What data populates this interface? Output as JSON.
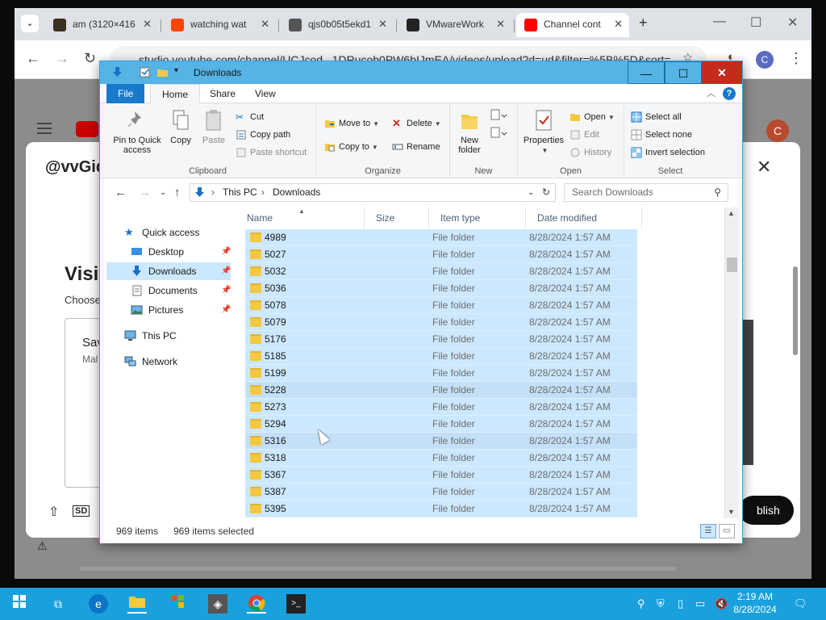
{
  "browser": {
    "tabs": [
      {
        "title": "am (3120×416",
        "favicon_color": "#3a3020"
      },
      {
        "title": "watching wat",
        "favicon_color": "#ff4500"
      },
      {
        "title": "qjs0b05t5ekd1",
        "favicon_color": "#555555"
      },
      {
        "title": "VMwareWork",
        "favicon_color": "#222222"
      },
      {
        "title": "Channel cont",
        "favicon_color": "#ff0000",
        "active": true
      }
    ],
    "url": "studio.youtube.com/channel/UCJcod...1DRucob0PW6bIJmEA/videos/upload?d=ud&filter=%5B%5D&sort=",
    "profile_initial": "C"
  },
  "youtube": {
    "channel": "@vvGid",
    "visibility_title": "Visil",
    "choose_text": "Choose",
    "save_text": "Sav",
    "make_text": "Mal",
    "publish_label": "blish",
    "user_initial": "C",
    "sd_badge": "SD"
  },
  "explorer": {
    "title": "Downloads",
    "ribbon_tabs": [
      "File",
      "Home",
      "Share",
      "View"
    ],
    "active_tab": "Home",
    "ribbon": {
      "clipboard": {
        "label": "Clipboard",
        "pin": "Pin to Quick access",
        "copy": "Copy",
        "paste": "Paste",
        "cut": "Cut",
        "copy_path": "Copy path",
        "paste_shortcut": "Paste shortcut"
      },
      "organize": {
        "label": "Organize",
        "move_to": "Move to",
        "copy_to": "Copy to",
        "delete": "Delete",
        "rename": "Rename"
      },
      "new": {
        "label": "New",
        "new_folder": "New folder"
      },
      "open": {
        "label": "Open",
        "properties": "Properties",
        "open": "Open",
        "edit": "Edit",
        "history": "History"
      },
      "select": {
        "label": "Select",
        "select_all": "Select all",
        "select_none": "Select none",
        "invert": "Invert selection"
      }
    },
    "address": {
      "segments": [
        "This PC",
        "Downloads"
      ],
      "search_placeholder": "Search Downloads"
    },
    "nav_pane": {
      "quick_access": "Quick access",
      "items": [
        {
          "label": "Desktop",
          "pinned": true
        },
        {
          "label": "Downloads",
          "pinned": true,
          "selected": true
        },
        {
          "label": "Documents",
          "pinned": true
        },
        {
          "label": "Pictures",
          "pinned": true
        }
      ],
      "this_pc": "This PC",
      "network": "Network"
    },
    "columns": [
      "Name",
      "Size",
      "Item type",
      "Date modified"
    ],
    "files": [
      {
        "name": "4989",
        "type": "File folder",
        "date": "8/28/2024 1:57 AM"
      },
      {
        "name": "5027",
        "type": "File folder",
        "date": "8/28/2024 1:57 AM"
      },
      {
        "name": "5032",
        "type": "File folder",
        "date": "8/28/2024 1:57 AM"
      },
      {
        "name": "5036",
        "type": "File folder",
        "date": "8/28/2024 1:57 AM"
      },
      {
        "name": "5078",
        "type": "File folder",
        "date": "8/28/2024 1:57 AM"
      },
      {
        "name": "5079",
        "type": "File folder",
        "date": "8/28/2024 1:57 AM"
      },
      {
        "name": "5176",
        "type": "File folder",
        "date": "8/28/2024 1:57 AM"
      },
      {
        "name": "5185",
        "type": "File folder",
        "date": "8/28/2024 1:57 AM"
      },
      {
        "name": "5199",
        "type": "File folder",
        "date": "8/28/2024 1:57 AM"
      },
      {
        "name": "5228",
        "type": "File folder",
        "date": "8/28/2024 1:57 AM",
        "hover": true
      },
      {
        "name": "5273",
        "type": "File folder",
        "date": "8/28/2024 1:57 AM"
      },
      {
        "name": "5294",
        "type": "File folder",
        "date": "8/28/2024 1:57 AM"
      },
      {
        "name": "5316",
        "type": "File folder",
        "date": "8/28/2024 1:57 AM",
        "hover": true
      },
      {
        "name": "5318",
        "type": "File folder",
        "date": "8/28/2024 1:57 AM"
      },
      {
        "name": "5367",
        "type": "File folder",
        "date": "8/28/2024 1:57 AM"
      },
      {
        "name": "5387",
        "type": "File folder",
        "date": "8/28/2024 1:57 AM"
      },
      {
        "name": "5395",
        "type": "File folder",
        "date": "8/28/2024 1:57 AM"
      }
    ],
    "status": {
      "item_count": "969 items",
      "selected": "969 items selected"
    }
  },
  "taskbar": {
    "time": "2:19 AM",
    "date": "8/28/2024",
    "accent": "#1aa1dd"
  }
}
